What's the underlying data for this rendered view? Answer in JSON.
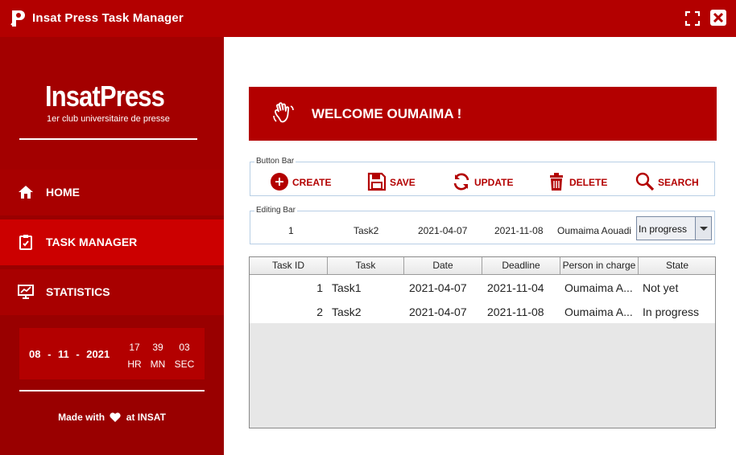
{
  "window": {
    "title": "Insat Press Task Manager"
  },
  "sidebar": {
    "logo": {
      "name": "InsatPress",
      "tagline": "1er club universitaire de presse"
    },
    "nav": [
      {
        "label": "HOME",
        "icon": "home-icon"
      },
      {
        "label": "TASK MANAGER",
        "icon": "clipboard-icon"
      },
      {
        "label": "STATISTICS",
        "icon": "chart-icon"
      }
    ],
    "clock": {
      "date": "08 - 11 - 2021",
      "hour": "17",
      "minute": "39",
      "second": "03",
      "hour_label": "HR",
      "minute_label": "MN",
      "second_label": "SEC"
    },
    "footer": {
      "made_with": "Made with",
      "at": "at INSAT"
    }
  },
  "main": {
    "welcome": "WELCOME OUMAIMA !",
    "button_bar": {
      "legend": "Button Bar",
      "buttons": [
        {
          "label": "CREATE",
          "icon": "plus-circle-icon"
        },
        {
          "label": "SAVE",
          "icon": "floppy-disk-icon"
        },
        {
          "label": "UPDATE",
          "icon": "refresh-icon"
        },
        {
          "label": "DELETE",
          "icon": "trash-icon"
        },
        {
          "label": "SEARCH",
          "icon": "magnifier-icon"
        }
      ]
    },
    "editing_bar": {
      "legend": "Editing Bar",
      "task_id": "1",
      "task": "Task2",
      "date": "2021-04-07",
      "deadline": "2021-11-08",
      "person": "Oumaima Aouadi",
      "state": "In progress"
    },
    "table": {
      "columns": [
        "Task ID",
        "Task",
        "Date",
        "Deadline",
        "Person in charge",
        "State"
      ],
      "rows": [
        [
          "1",
          "Task1",
          "2021-04-07",
          "2021-11-04",
          "Oumaima A...",
          "Not yet"
        ],
        [
          "2",
          "Task2",
          "2021-04-07",
          "2021-11-08",
          "Oumaima A...",
          "In progress"
        ]
      ]
    }
  },
  "colors": {
    "brand_red": "#b30000",
    "sidebar_dark": "#990000",
    "nav_active": "#cc0000"
  }
}
